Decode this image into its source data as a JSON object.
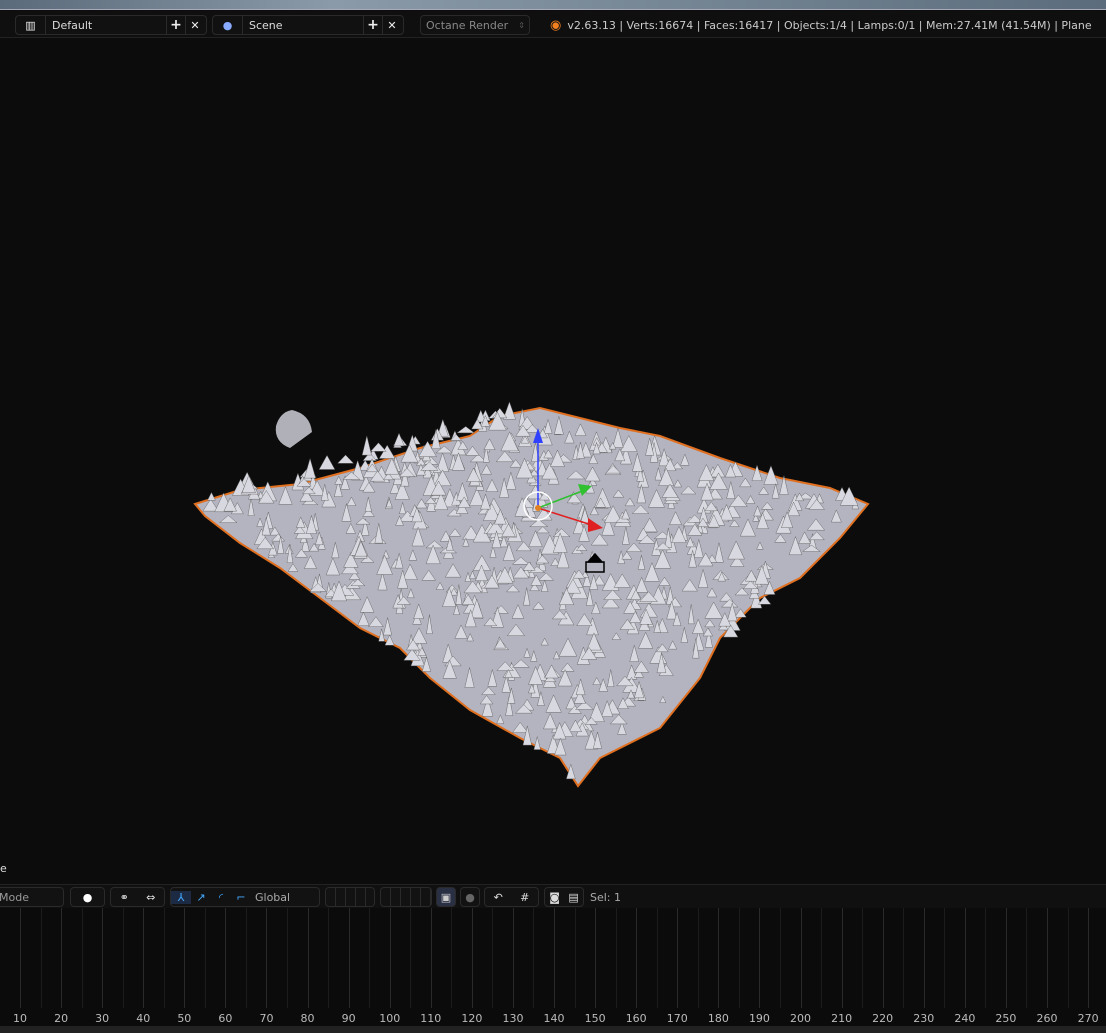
{
  "header": {
    "layout_name": "Default",
    "scene_name": "Scene",
    "render_engine": "Octane Render",
    "add_label": "+",
    "close_label": "✕",
    "stats": "v2.63.13 | Verts:16674 | Faces:16417 | Objects:1/4 | Lamps:0/1 | Mem:27.41M (41.54M) | Plane"
  },
  "viewport": {
    "object_label": "e"
  },
  "toolbar": {
    "mode": "Mode",
    "orientation": "Global",
    "selection": "Sel: 1"
  },
  "timeline": {
    "ticks": [
      10,
      20,
      30,
      40,
      50,
      60,
      70,
      80,
      90,
      100,
      110,
      120,
      130,
      140,
      150,
      160,
      170,
      180,
      190,
      200,
      210,
      220,
      230,
      240,
      250,
      260,
      270
    ]
  },
  "colors": {
    "mesh": "#b8b8c4",
    "outline": "#e07020",
    "x_axis": "#e02020",
    "y_axis": "#30c030",
    "z_axis": "#3040ff",
    "blender_logo": "#f08020"
  }
}
